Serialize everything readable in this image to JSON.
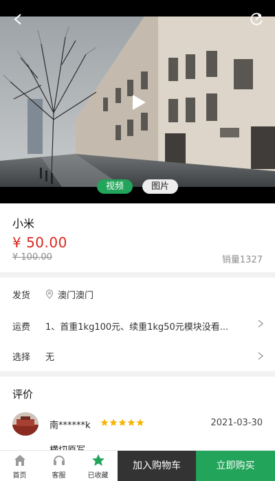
{
  "media": {
    "tabs": [
      {
        "label": "视频",
        "active": true
      },
      {
        "label": "图片",
        "active": false
      }
    ],
    "accent_color": "#22a45a"
  },
  "product": {
    "name": "小米",
    "price": "¥ 50.00",
    "original_price": "¥ 100.00",
    "sales": "销量1327",
    "price_color": "#d9261c"
  },
  "options": {
    "shipping": {
      "label": "发货",
      "value": "澳门澳门",
      "icon": "location-pin-icon"
    },
    "freight": {
      "label": "运费",
      "value": "1、首重1kg100元、续重1kg50元模块没看..."
    },
    "select": {
      "label": "选择",
      "value": "无"
    }
  },
  "reviews": {
    "title": "评价",
    "items": [
      {
        "name": "南******k",
        "stars": 5,
        "date": "2021-03-30"
      }
    ],
    "next_partial": "横切原写"
  },
  "bottom_nav": {
    "items": [
      {
        "label": "首页",
        "icon": "home-icon"
      },
      {
        "label": "客服",
        "icon": "headset-icon"
      },
      {
        "label": "已收藏",
        "icon": "star-filled-icon"
      }
    ],
    "add_to_cart": "加入购物车",
    "buy_now": "立即购买"
  }
}
